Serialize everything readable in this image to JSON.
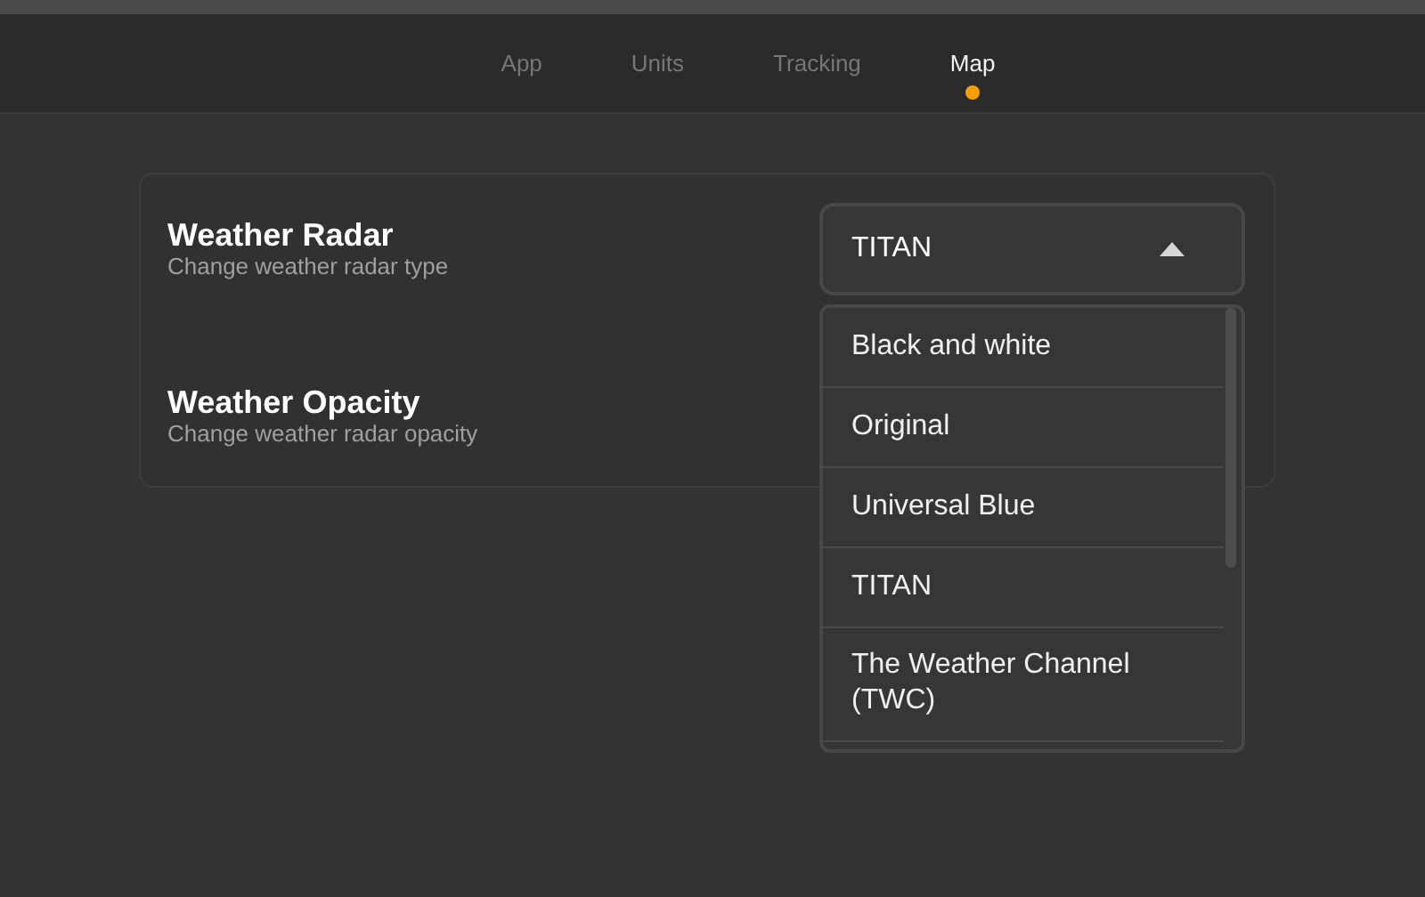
{
  "tabs": [
    {
      "label": "App",
      "selected": false
    },
    {
      "label": "Units",
      "selected": false
    },
    {
      "label": "Tracking",
      "selected": false
    },
    {
      "label": "Map",
      "selected": true
    }
  ],
  "settings": [
    {
      "title": "Weather Radar",
      "description": "Change weather radar type",
      "kind": "dropdown",
      "value": "TITAN",
      "expanded": true,
      "options": [
        "Black and white",
        "Original",
        "Universal Blue",
        "TITAN",
        "The Weather Channel (TWC)"
      ]
    },
    {
      "title": "Weather Opacity",
      "description": "Change weather radar opacity",
      "kind": "none"
    }
  ]
}
